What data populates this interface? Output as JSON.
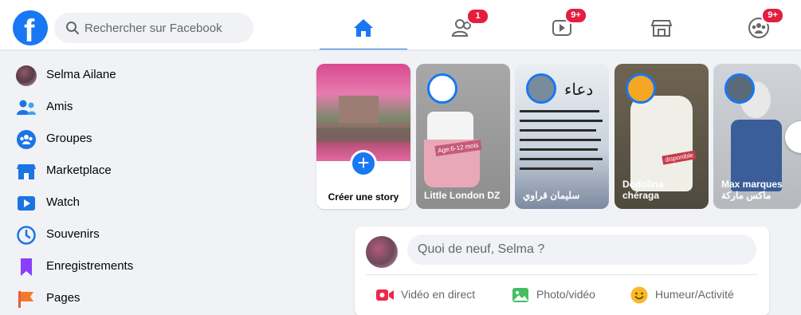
{
  "header": {
    "search_placeholder": "Rechercher sur Facebook",
    "tabs": [
      {
        "name": "home",
        "badge": ""
      },
      {
        "name": "friends",
        "badge": "1"
      },
      {
        "name": "watch",
        "badge": "9+"
      },
      {
        "name": "marketplace",
        "badge": ""
      },
      {
        "name": "groups",
        "badge": "9+"
      }
    ],
    "accent_color": "#1877f2",
    "badge_color": "#e41e3f"
  },
  "sidebar": {
    "items": [
      {
        "label": "Selma Ailane",
        "icon": "profile-avatar"
      },
      {
        "label": "Amis",
        "icon": "friends-icon"
      },
      {
        "label": "Groupes",
        "icon": "groups-icon"
      },
      {
        "label": "Marketplace",
        "icon": "marketplace-icon"
      },
      {
        "label": "Watch",
        "icon": "watch-icon"
      },
      {
        "label": "Souvenirs",
        "icon": "memories-icon"
      },
      {
        "label": "Enregistrements",
        "icon": "saved-icon"
      },
      {
        "label": "Pages",
        "icon": "pages-icon"
      }
    ]
  },
  "stories": {
    "create_label": "Créer une story",
    "items": [
      {
        "name": "Little London DZ",
        "image_text": "Age:6-12 mois"
      },
      {
        "name": "سليمان قراوي",
        "image_text": "دعاء"
      },
      {
        "name": "Dodolina chéraga",
        "image_text": "disponible"
      },
      {
        "name": "Max marques ماكس ماركة",
        "image_text": ""
      }
    ]
  },
  "composer": {
    "placeholder": "Quoi de neuf, Selma ?",
    "actions": [
      {
        "label": "Vidéo en direct",
        "icon": "live-video-icon",
        "color": "#f02849"
      },
      {
        "label": "Photo/vidéo",
        "icon": "photo-icon",
        "color": "#45bd62"
      },
      {
        "label": "Humeur/Activité",
        "icon": "feeling-icon",
        "color": "#f7b928"
      }
    ]
  }
}
